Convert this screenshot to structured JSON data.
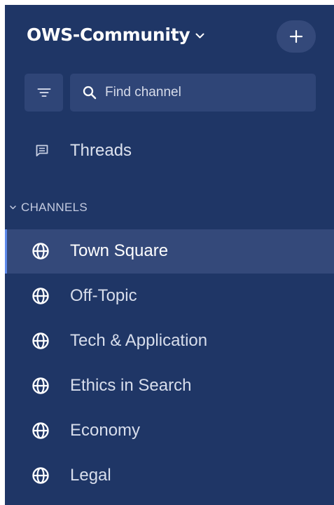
{
  "colors": {
    "sidebar_bg": "#1f3666",
    "hover_bg": "#34497a",
    "active_indicator": "#5d89ea",
    "text": "#ffffff"
  },
  "header": {
    "team_name": "OWS-Community",
    "team_chevron_icon": "chevron-down-icon",
    "add_icon": "plus-icon"
  },
  "filter": {
    "icon": "filter-icon"
  },
  "search": {
    "icon": "search-icon",
    "placeholder": "Find channel"
  },
  "threads": {
    "icon": "threads-icon",
    "label": "Threads"
  },
  "channels_section": {
    "label": "CHANNELS",
    "icon": "chevron-down-icon",
    "items": [
      {
        "label": "Town Square",
        "icon": "globe-icon",
        "active": true
      },
      {
        "label": "Off-Topic",
        "icon": "globe-icon",
        "active": false
      },
      {
        "label": "Tech & Application",
        "icon": "globe-icon",
        "active": false
      },
      {
        "label": "Ethics in Search",
        "icon": "globe-icon",
        "active": false
      },
      {
        "label": "Economy",
        "icon": "globe-icon",
        "active": false
      },
      {
        "label": "Legal",
        "icon": "globe-icon",
        "active": false
      }
    ]
  }
}
